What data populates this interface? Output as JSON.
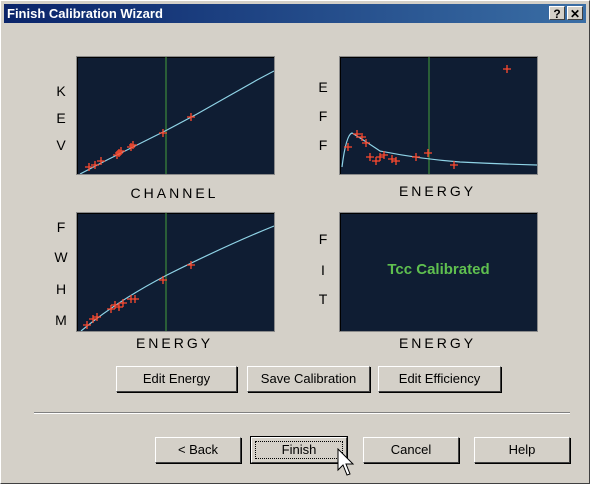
{
  "window": {
    "title": "Finish Calibration Wizard",
    "help_glyph": "?",
    "close_glyph": "✕"
  },
  "plots": {
    "kev": {
      "ylabel": [
        "K",
        "E",
        "V"
      ],
      "xlabel": "CHANNEL"
    },
    "eff": {
      "ylabel": [
        "E",
        "F",
        "F"
      ],
      "xlabel": "ENERGY"
    },
    "fwhm": {
      "ylabel": [
        "F",
        "W",
        "H",
        "M"
      ],
      "xlabel": "ENERGY"
    },
    "fit": {
      "ylabel": [
        "F",
        "I",
        "T"
      ],
      "xlabel": "ENERGY",
      "status": "Tcc Calibrated"
    }
  },
  "actions": {
    "edit_energy": "Edit Energy",
    "save_calibration": "Save Calibration",
    "edit_efficiency": "Edit Efficiency"
  },
  "footer": {
    "back": "< Back",
    "finish": "Finish",
    "cancel": "Cancel",
    "help": "Help"
  },
  "colors": {
    "plot_bg": "#0f1d33",
    "curve": "#8fd3e6",
    "marker": "#ff4a2e",
    "cursor_line": "#3d8a3a",
    "status_text": "#5fbf4f",
    "titlebar": "#0a246a"
  }
}
